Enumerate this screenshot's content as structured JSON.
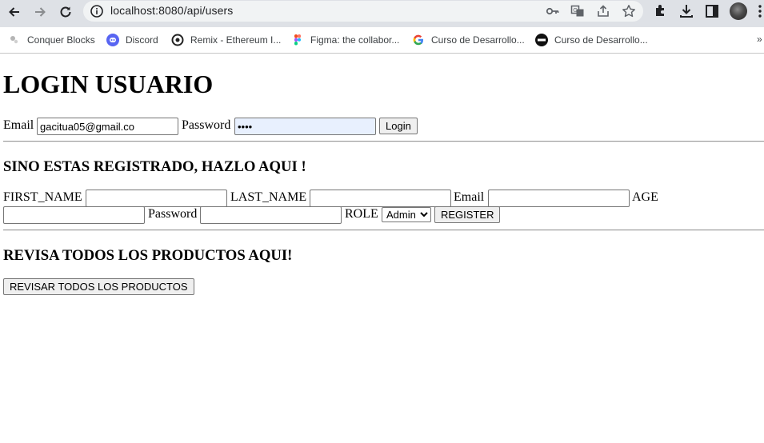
{
  "browser": {
    "url": "localhost:8080/api/users",
    "bookmarks": [
      {
        "label": "Conquer Blocks",
        "icon": "conquer-blocks-icon"
      },
      {
        "label": "Discord",
        "icon": "discord-icon"
      },
      {
        "label": "Remix - Ethereum I...",
        "icon": "remix-icon"
      },
      {
        "label": "Figma: the collabor...",
        "icon": "figma-icon"
      },
      {
        "label": "Curso de Desarrollo...",
        "icon": "google-icon"
      },
      {
        "label": "Curso de Desarrollo...",
        "icon": "course-icon"
      }
    ],
    "more": "»"
  },
  "login": {
    "title": "LOGIN USUARIO",
    "email_label": "Email",
    "email_value": "gacitua05@gmail.co",
    "password_label": "Password",
    "password_value": "••••",
    "login_button": "Login"
  },
  "register": {
    "heading": "SINO ESTAS REGISTRADO, HAZLO AQUI !",
    "first_name_label": "FIRST_NAME",
    "last_name_label": "LAST_NAME",
    "email_label": "Email",
    "age_label": "AGE",
    "password_label": "Password",
    "role_label": "ROLE",
    "role_selected": "Admin",
    "register_button": "REGISTER"
  },
  "products": {
    "heading": "REVISA TODOS LOS PRODUCTOS AQUI!",
    "button": "REVISAR TODOS LOS PRODUCTOS"
  }
}
